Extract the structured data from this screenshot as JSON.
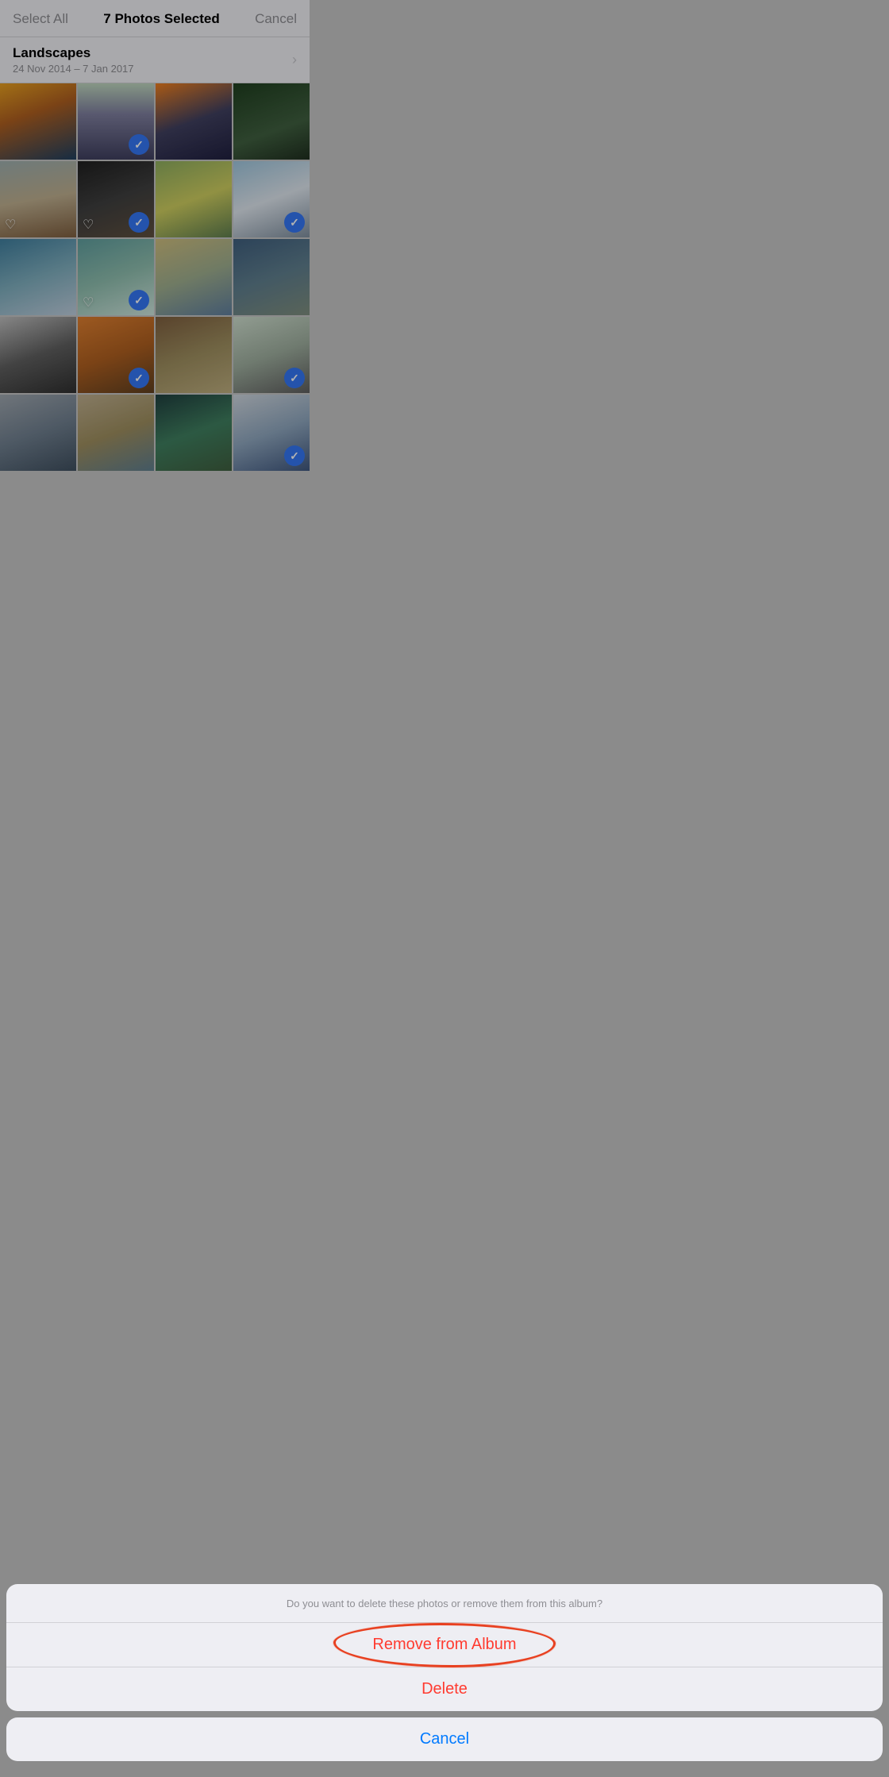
{
  "header": {
    "select_all_label": "Select All",
    "title_count": "7",
    "title_suffix": "Photos Selected",
    "cancel_label": "Cancel"
  },
  "album": {
    "name": "Landscapes",
    "date_range": "24 Nov 2014 – 7 Jan 2017"
  },
  "photos": [
    {
      "id": 1,
      "class": "p1",
      "selected": false,
      "favorited": false
    },
    {
      "id": 2,
      "class": "p2",
      "selected": true,
      "favorited": false
    },
    {
      "id": 3,
      "class": "p3",
      "selected": false,
      "favorited": false
    },
    {
      "id": 4,
      "class": "p4",
      "selected": false,
      "favorited": false
    },
    {
      "id": 5,
      "class": "p5",
      "selected": false,
      "favorited": true
    },
    {
      "id": 6,
      "class": "p6",
      "selected": true,
      "favorited": true
    },
    {
      "id": 7,
      "class": "p7",
      "selected": false,
      "favorited": false
    },
    {
      "id": 8,
      "class": "p8",
      "selected": true,
      "favorited": false
    },
    {
      "id": 9,
      "class": "p9",
      "selected": false,
      "favorited": false
    },
    {
      "id": 10,
      "class": "p10",
      "selected": true,
      "favorited": true
    },
    {
      "id": 11,
      "class": "p11",
      "selected": false,
      "favorited": false
    },
    {
      "id": 12,
      "class": "p12",
      "selected": false,
      "favorited": false
    },
    {
      "id": 13,
      "class": "p13",
      "selected": false,
      "favorited": false
    },
    {
      "id": 14,
      "class": "p14",
      "selected": true,
      "favorited": false
    },
    {
      "id": 15,
      "class": "p15",
      "selected": false,
      "favorited": false
    },
    {
      "id": 16,
      "class": "p16",
      "selected": true,
      "favorited": false
    },
    {
      "id": 17,
      "class": "p17",
      "selected": false,
      "favorited": false
    },
    {
      "id": 18,
      "class": "p18",
      "selected": false,
      "favorited": false
    },
    {
      "id": 19,
      "class": "p19",
      "selected": false,
      "favorited": false
    },
    {
      "id": 20,
      "class": "p20",
      "selected": true,
      "favorited": false
    }
  ],
  "action_sheet": {
    "message": "Do you want to delete these photos or remove them from this album?",
    "remove_label": "Remove from Album",
    "delete_label": "Delete",
    "cancel_label": "Cancel"
  }
}
